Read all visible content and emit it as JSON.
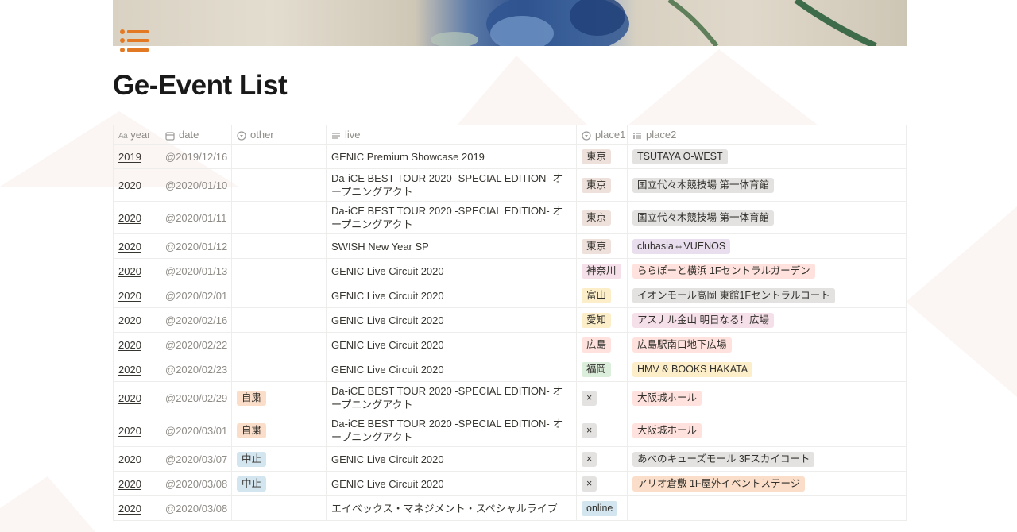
{
  "page": {
    "title": "Ge-Event List",
    "icon": "bulleted-list-icon"
  },
  "colors": {
    "icon_accent": "#e37a23",
    "title": "#191919",
    "muted_text": "#8f8c87"
  },
  "table": {
    "columns": [
      {
        "label": "year",
        "icon": "text-aa-icon"
      },
      {
        "label": "date",
        "icon": "calendar-icon"
      },
      {
        "label": "other",
        "icon": "select-circle-icon"
      },
      {
        "label": "live",
        "icon": "text-lines-icon"
      },
      {
        "label": "place1",
        "icon": "select-circle-icon"
      },
      {
        "label": "place2",
        "icon": "multi-select-list-icon"
      }
    ],
    "rows": [
      {
        "year": "2019",
        "date": "@2019/12/16",
        "other": "",
        "live": "GENIC Premium Showcase 2019",
        "place1": "東京",
        "place2": "TSUTAYA O-WEST"
      },
      {
        "year": "2020",
        "date": "@2020/01/10",
        "other": "",
        "live": "Da-iCE BEST TOUR 2020 -SPECIAL EDITION- オープニングアクト",
        "place1": "東京",
        "place2": "国立代々木競技場 第一体育館"
      },
      {
        "year": "2020",
        "date": "@2020/01/11",
        "other": "",
        "live": "Da-iCE BEST TOUR 2020 -SPECIAL EDITION- オープニングアクト",
        "place1": "東京",
        "place2": "国立代々木競技場 第一体育館"
      },
      {
        "year": "2020",
        "date": "@2020/01/12",
        "other": "",
        "live": "SWISH New Year SP",
        "place1": "東京",
        "place2": "clubasia⇔VUENOS"
      },
      {
        "year": "2020",
        "date": "@2020/01/13",
        "other": "",
        "live": "GENIC Live Circuit 2020",
        "place1": "神奈川",
        "place2": "ららぽーと横浜 1Fセントラルガーデン"
      },
      {
        "year": "2020",
        "date": "@2020/02/01",
        "other": "",
        "live": "GENIC Live Circuit 2020",
        "place1": "富山",
        "place2": "イオンモール高岡 東館1Fセントラルコート"
      },
      {
        "year": "2020",
        "date": "@2020/02/16",
        "other": "",
        "live": "GENIC Live Circuit 2020",
        "place1": "愛知",
        "place2": "アスナル金山 明日なる！広場"
      },
      {
        "year": "2020",
        "date": "@2020/02/22",
        "other": "",
        "live": "GENIC Live Circuit 2020",
        "place1": "広島",
        "place2": "広島駅南口地下広場"
      },
      {
        "year": "2020",
        "date": "@2020/02/23",
        "other": "",
        "live": "GENIC Live Circuit 2020",
        "place1": "福岡",
        "place2": "HMV & BOOKS HAKATA"
      },
      {
        "year": "2020",
        "date": "@2020/02/29",
        "other": "自粛",
        "live": "Da-iCE BEST TOUR 2020 -SPECIAL EDITION- オープニングアクト",
        "place1": "×",
        "place2": "大阪城ホール"
      },
      {
        "year": "2020",
        "date": "@2020/03/01",
        "other": "自粛",
        "live": "Da-iCE BEST TOUR 2020 -SPECIAL EDITION- オープニングアクト",
        "place1": "×",
        "place2": "大阪城ホール"
      },
      {
        "year": "2020",
        "date": "@2020/03/07",
        "other": "中止",
        "live": "GENIC Live Circuit 2020",
        "place1": "×",
        "place2": "あべのキューズモール 3Fスカイコート"
      },
      {
        "year": "2020",
        "date": "@2020/03/08",
        "other": "中止",
        "live": "GENIC Live Circuit 2020",
        "place1": "×",
        "place2": "アリオ倉敷 1F屋外イベントステージ"
      },
      {
        "year": "2020",
        "date": "@2020/03/08",
        "other": "",
        "live": "エイベックス・マネジメント・スペシャルライブ",
        "place1": "online",
        "place2": ""
      }
    ]
  }
}
